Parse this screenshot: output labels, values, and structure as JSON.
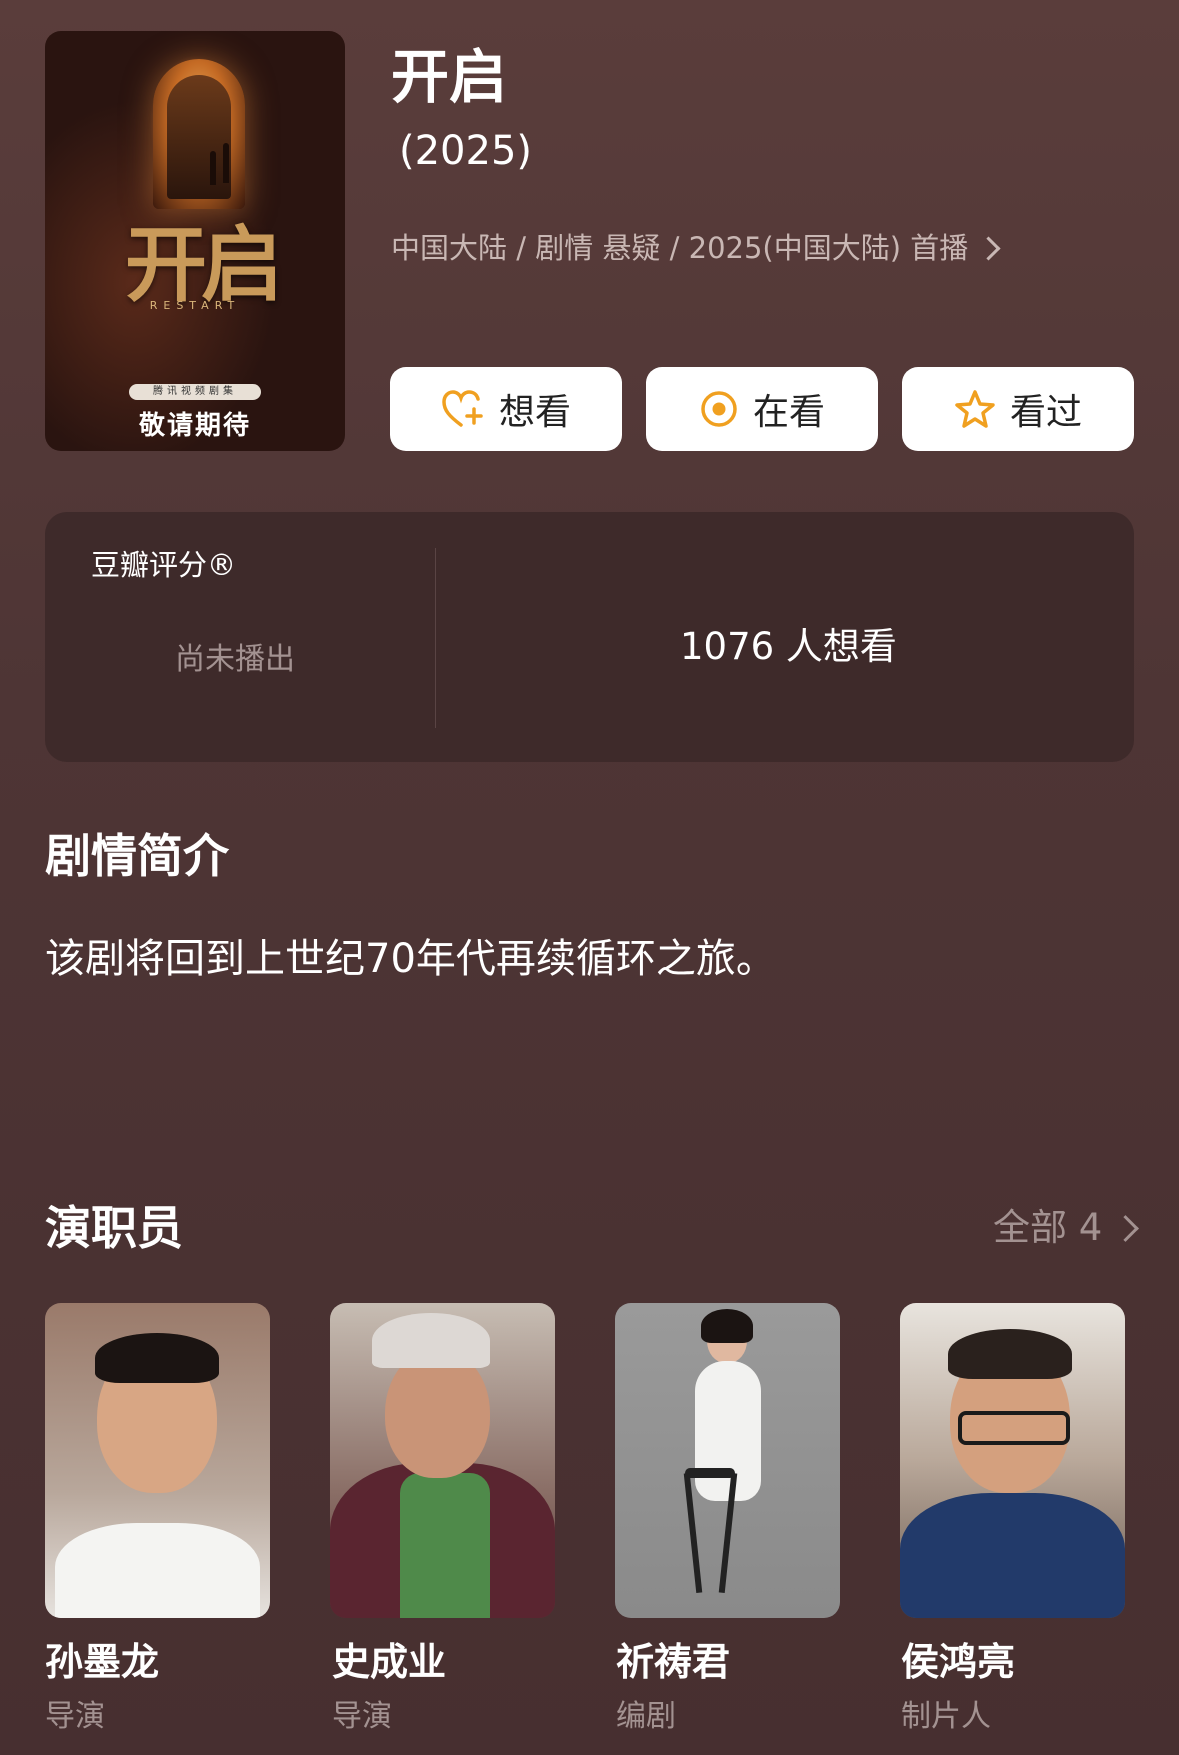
{
  "poster": {
    "title_art": "开启",
    "subtitle_art": "RESTART",
    "badge": "腾讯视频剧集",
    "cta": "敬请期待"
  },
  "show": {
    "title": "开启",
    "year": "(2025)",
    "meta": "中国大陆 / 剧情 悬疑 / 2025(中国大陆) 首播"
  },
  "actions": {
    "want": "想看",
    "watching": "在看",
    "watched": "看过"
  },
  "rating": {
    "label": "豆瓣评分®",
    "status": "尚未播出",
    "wants": "1076 人想看"
  },
  "synopsis": {
    "heading": "剧情简介",
    "text": "该剧将回到上世纪70年代再续循环之旅。"
  },
  "cast": {
    "heading": "演职员",
    "all_label": "全部 4",
    "members": [
      {
        "name": "孙墨龙",
        "role": "导演"
      },
      {
        "name": "史成业",
        "role": "导演"
      },
      {
        "name": "祈祷君",
        "role": "编剧"
      },
      {
        "name": "侯鸿亮",
        "role": "制片人"
      }
    ]
  },
  "colors": {
    "background": "#4e3535",
    "card": "#3e2a2a",
    "accent": "#f0a020",
    "muted": "#a39291"
  }
}
